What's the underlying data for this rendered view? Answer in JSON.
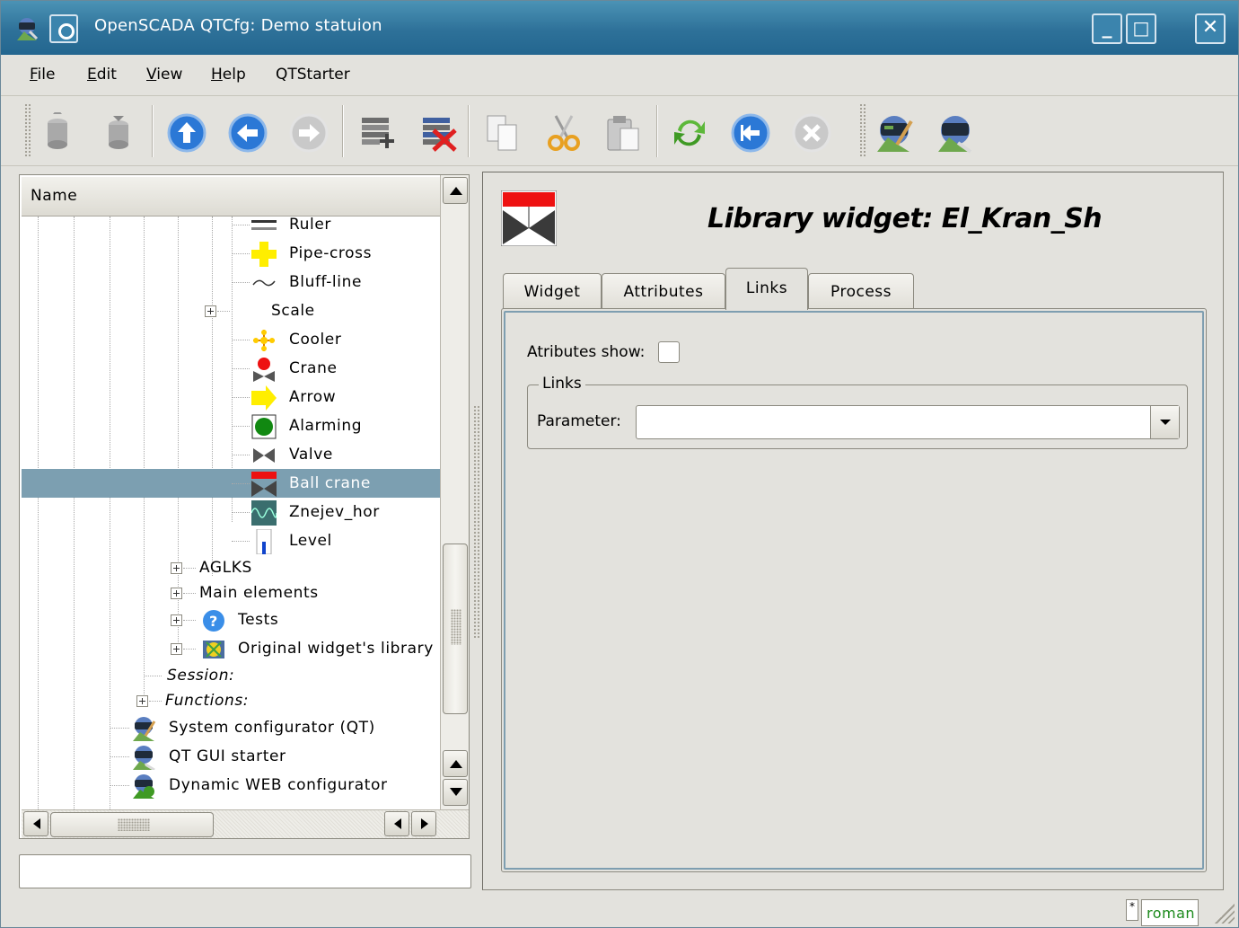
{
  "window": {
    "title": "OpenSCADA QTCfg: Demo statuion",
    "buttons": [
      "_",
      "□",
      "✕"
    ]
  },
  "menubar": {
    "items": [
      {
        "label": "File",
        "underline": "F"
      },
      {
        "label": "Edit",
        "underline": "E"
      },
      {
        "label": "View",
        "underline": "V"
      },
      {
        "label": "Help",
        "underline": "H"
      },
      {
        "label": "QTStarter",
        "underline": ""
      }
    ]
  },
  "toolbar": {
    "icons": [
      "db-load-icon",
      "db-save-icon",
      "up-icon",
      "back-icon",
      "forward-icon",
      "add-item-icon",
      "delete-item-icon",
      "copy-icon",
      "cut-icon",
      "paste-icon",
      "refresh-icon",
      "start-icon",
      "stop-icon",
      "qtcfg-app-icon",
      "qtstarter-app-icon"
    ]
  },
  "tree": {
    "header": "Name",
    "rows": [
      {
        "label": "Ruler",
        "icon": "ruler-icon",
        "italic": false
      },
      {
        "label": "Pipe-cross",
        "icon": "pipe-cross-icon",
        "italic": false
      },
      {
        "label": "Bluff-line",
        "icon": "bluff-line-icon",
        "italic": false
      },
      {
        "label": "Scale",
        "icon": "",
        "italic": false
      },
      {
        "label": "Cooler",
        "icon": "cooler-icon",
        "italic": false
      },
      {
        "label": "Crane",
        "icon": "crane-icon",
        "italic": false
      },
      {
        "label": "Arrow",
        "icon": "arrow-icon",
        "italic": false
      },
      {
        "label": "Alarming",
        "icon": "alarming-icon",
        "italic": false
      },
      {
        "label": "Valve",
        "icon": "valve-icon",
        "italic": false
      },
      {
        "label": "Ball crane",
        "icon": "ball-crane-icon",
        "italic": false,
        "selected": true
      },
      {
        "label": "Znejev_hor",
        "icon": "znejev-icon",
        "italic": false
      },
      {
        "label": "Level",
        "icon": "level-icon",
        "italic": false
      },
      {
        "label": "AGLKS",
        "icon": "",
        "italic": false
      },
      {
        "label": "Main elements",
        "icon": "",
        "italic": false
      },
      {
        "label": "Tests",
        "icon": "help-icon",
        "italic": false
      },
      {
        "label": "Original widget's library",
        "icon": "library-icon",
        "italic": false
      },
      {
        "label": "Session:",
        "icon": "",
        "italic": true
      },
      {
        "label": "Functions:",
        "icon": "",
        "italic": true
      },
      {
        "label": "System configurator (QT)",
        "icon": "configurator-icon",
        "italic": false
      },
      {
        "label": "QT GUI starter",
        "icon": "starter-icon",
        "italic": false
      },
      {
        "label": "Dynamic WEB configurator",
        "icon": "web-configurator-icon",
        "italic": false
      }
    ]
  },
  "page": {
    "title": "Library widget: El_Kran_Sh",
    "tabs": [
      "Widget",
      "Attributes",
      "Links",
      "Process"
    ],
    "active_tab": "Links",
    "attributes_show_label": "Atributes show:",
    "attributes_show_checked": false,
    "links_group_title": "Links",
    "parameter_label": "Parameter:",
    "parameter_value": ""
  },
  "statusbar": {
    "modified": "*",
    "user": "roman"
  },
  "colors": {
    "titlebar": "#2e7199",
    "selection": "#7c9fb1",
    "background": "#e3e2dd",
    "user_text": "#1c8a1c"
  }
}
